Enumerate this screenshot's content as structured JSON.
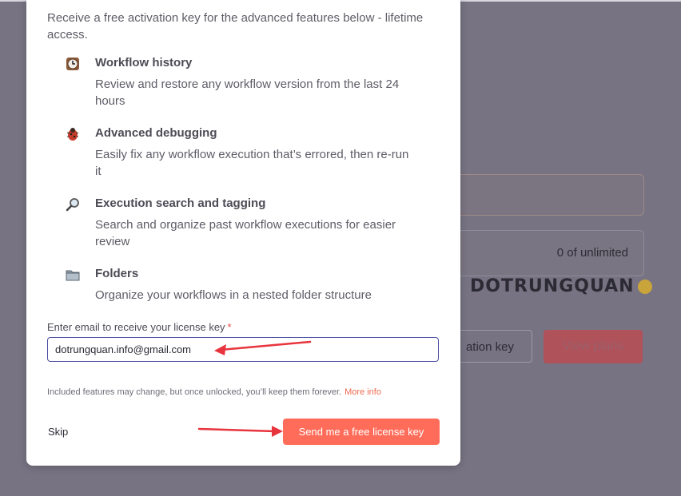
{
  "background": {
    "usage_text": "0 of unlimited",
    "outline_button_label": "ation key",
    "primary_button_label": "View plans",
    "watermark": "DOTRUNGQUAN"
  },
  "modal": {
    "intro": "Receive a free activation key for the advanced features below - lifetime access.",
    "features": [
      {
        "icon": "clock-icon",
        "title": "Workflow history",
        "description": "Review and restore any workflow version from the last 24 hours"
      },
      {
        "icon": "bug-icon",
        "title": "Advanced debugging",
        "description": "Easily fix any workflow execution that’s errored, then re-run it"
      },
      {
        "icon": "magnifier-icon",
        "title": "Execution search and tagging",
        "description": "Search and organize past workflow executions for easier review"
      },
      {
        "icon": "folder-icon",
        "title": "Folders",
        "description": "Organize your workflows in a nested folder structure"
      }
    ],
    "email_label": "Enter email to receive your license key",
    "email_required_mark": "*",
    "email_value": "dotrungquan.info@gmail.com",
    "note": "Included features may change, but once unlocked, you’ll keep them forever.",
    "more_info": "More info",
    "skip_label": "Skip",
    "send_label": "Send me a free license key"
  },
  "colors": {
    "accent": "#ff6d5a",
    "overlay": "#777383",
    "annotation_arrow": "#e8343c"
  }
}
